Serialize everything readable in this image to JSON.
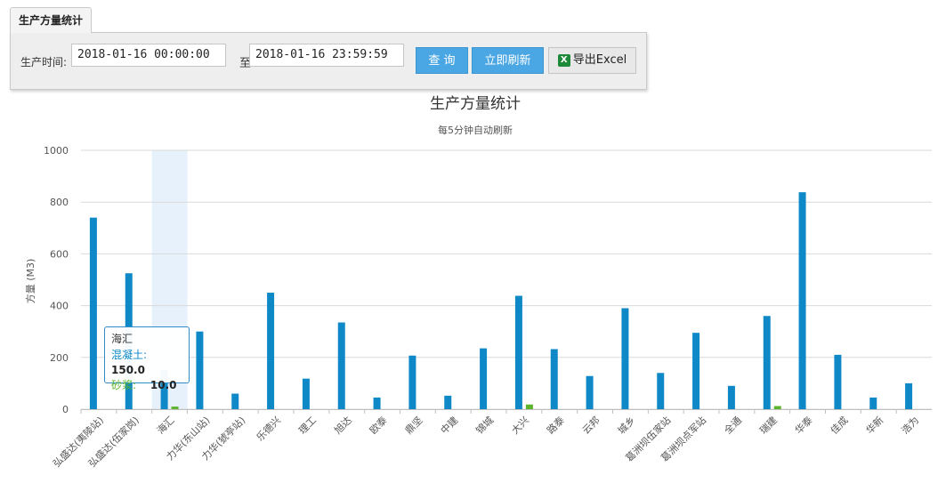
{
  "tab": {
    "label": "生产方量统计"
  },
  "filter": {
    "time_label": "生产时间:",
    "start_value": "2018-01-16 00:00:00",
    "to_label": "至",
    "end_value": "2018-01-16 23:59:59",
    "query_button": "查 询",
    "refresh_button": "立即刷新",
    "export_button": "导出Excel",
    "export_icon": "excel-icon"
  },
  "tooltip": {
    "title": "海汇",
    "concrete_label": "混凝土:",
    "concrete_value": "150.0",
    "mortar_label": "砂浆:",
    "mortar_value": "10.0"
  },
  "chart_data": {
    "type": "bar",
    "title": "生产方量统计",
    "subtitle": "每5分钟自动刷新",
    "ylabel": "方量 (M3)",
    "xlabel": "",
    "ylim": [
      0,
      1000
    ],
    "yticks": [
      0,
      200,
      400,
      600,
      800,
      1000
    ],
    "grid": true,
    "highlighted_category": "海汇",
    "categories": [
      "弘盛达(夷陵站)",
      "弘盛达(伍家岗)",
      "海汇",
      "力华(东山站)",
      "力华(猇亭站)",
      "乐德兴",
      "理工",
      "旭达",
      "欧泰",
      "鼎坚",
      "中建",
      "锦城",
      "大兴",
      "路泰",
      "云邦",
      "城乡",
      "葛洲坝伍家站",
      "葛洲坝点军站",
      "全通",
      "瑞建",
      "华泰",
      "佳成",
      "华新",
      "浩为"
    ],
    "series": [
      {
        "name": "混凝土",
        "color": "#0e88c7",
        "values": [
          740,
          525,
          150,
          300,
          60,
          450,
          118,
          335,
          45,
          207,
          52,
          235,
          438,
          232,
          128,
          390,
          140,
          295,
          90,
          360,
          838,
          210,
          45,
          100
        ]
      },
      {
        "name": "砂浆",
        "color": "#5bb42b",
        "values": [
          0,
          0,
          10,
          0,
          0,
          0,
          0,
          0,
          0,
          0,
          0,
          0,
          18,
          0,
          0,
          0,
          0,
          0,
          0,
          12,
          0,
          0,
          0,
          0
        ]
      }
    ]
  }
}
